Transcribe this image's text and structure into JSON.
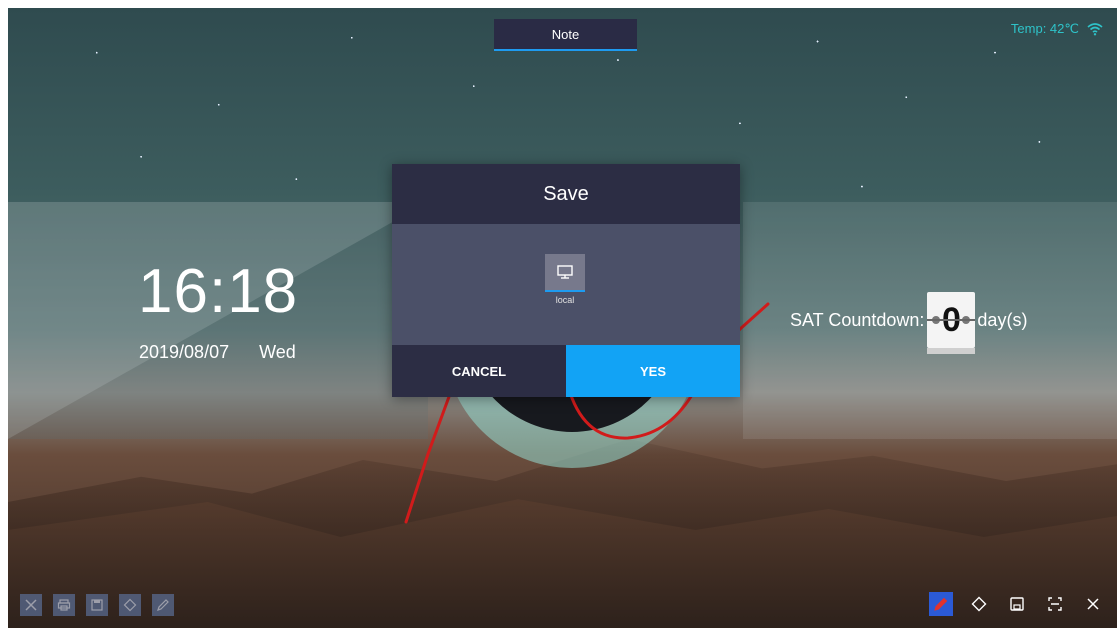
{
  "header": {
    "note_tab": "Note"
  },
  "status": {
    "temp": "Temp: 42℃",
    "wifi_icon": "wifi-icon"
  },
  "clock": {
    "time": "16:18",
    "date": "2019/08/07",
    "weekday": "Wed"
  },
  "countdown": {
    "label": "SAT Countdown:",
    "days_value": "0",
    "unit": "day(s)"
  },
  "dialog": {
    "title": "Save",
    "storage_option": {
      "label": "local",
      "icon": "monitor-icon"
    },
    "cancel_label": "CANCEL",
    "yes_label": "YES"
  },
  "toolbar_left": {
    "icons": [
      "close-icon",
      "print-icon",
      "save-icon",
      "eraser-icon",
      "pen-icon"
    ]
  },
  "toolbar_right": {
    "icons": [
      "pen-icon",
      "eraser-icon",
      "save-icon",
      "fullscreen-icon",
      "close-icon"
    ]
  },
  "colors": {
    "accent": "#12a3f5",
    "dialog_dark": "#2c2d44",
    "dialog_body": "#4b5068",
    "status_text": "#2ec3c9",
    "active_tool": "#2b5ad6"
  }
}
